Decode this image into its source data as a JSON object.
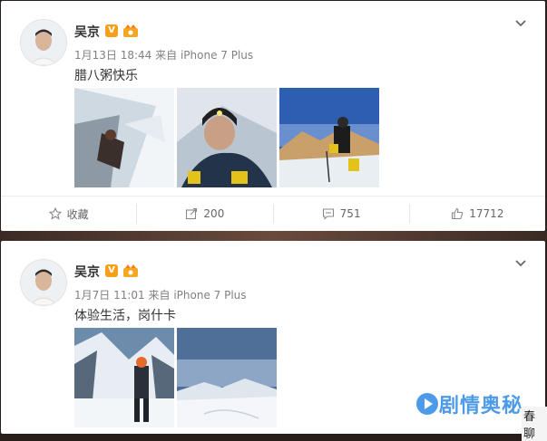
{
  "posts": [
    {
      "author": "吴京",
      "verified_label": "V",
      "time": "1月13日 18:44",
      "source": "来自 iPhone 7 Plus",
      "text": "腊八粥快乐",
      "photos": [
        "ice-climb",
        "portrait-headlamp",
        "summit-sunrise"
      ],
      "actions": {
        "favorite": "收藏",
        "repost": "200",
        "comment": "751",
        "like": "17712"
      }
    },
    {
      "author": "吴京",
      "verified_label": "V",
      "time": "1月7日 11:01",
      "source": "来自 iPhone 7 Plus",
      "text": "体验生活，岗什卡",
      "photos": [
        "snow-standing",
        "snow-field"
      ]
    }
  ],
  "watermark": {
    "brand": "剧情奥秘",
    "tail": "春聊"
  },
  "colors": {
    "verified": "#f6a01a",
    "watermark": "#4d9be8"
  }
}
